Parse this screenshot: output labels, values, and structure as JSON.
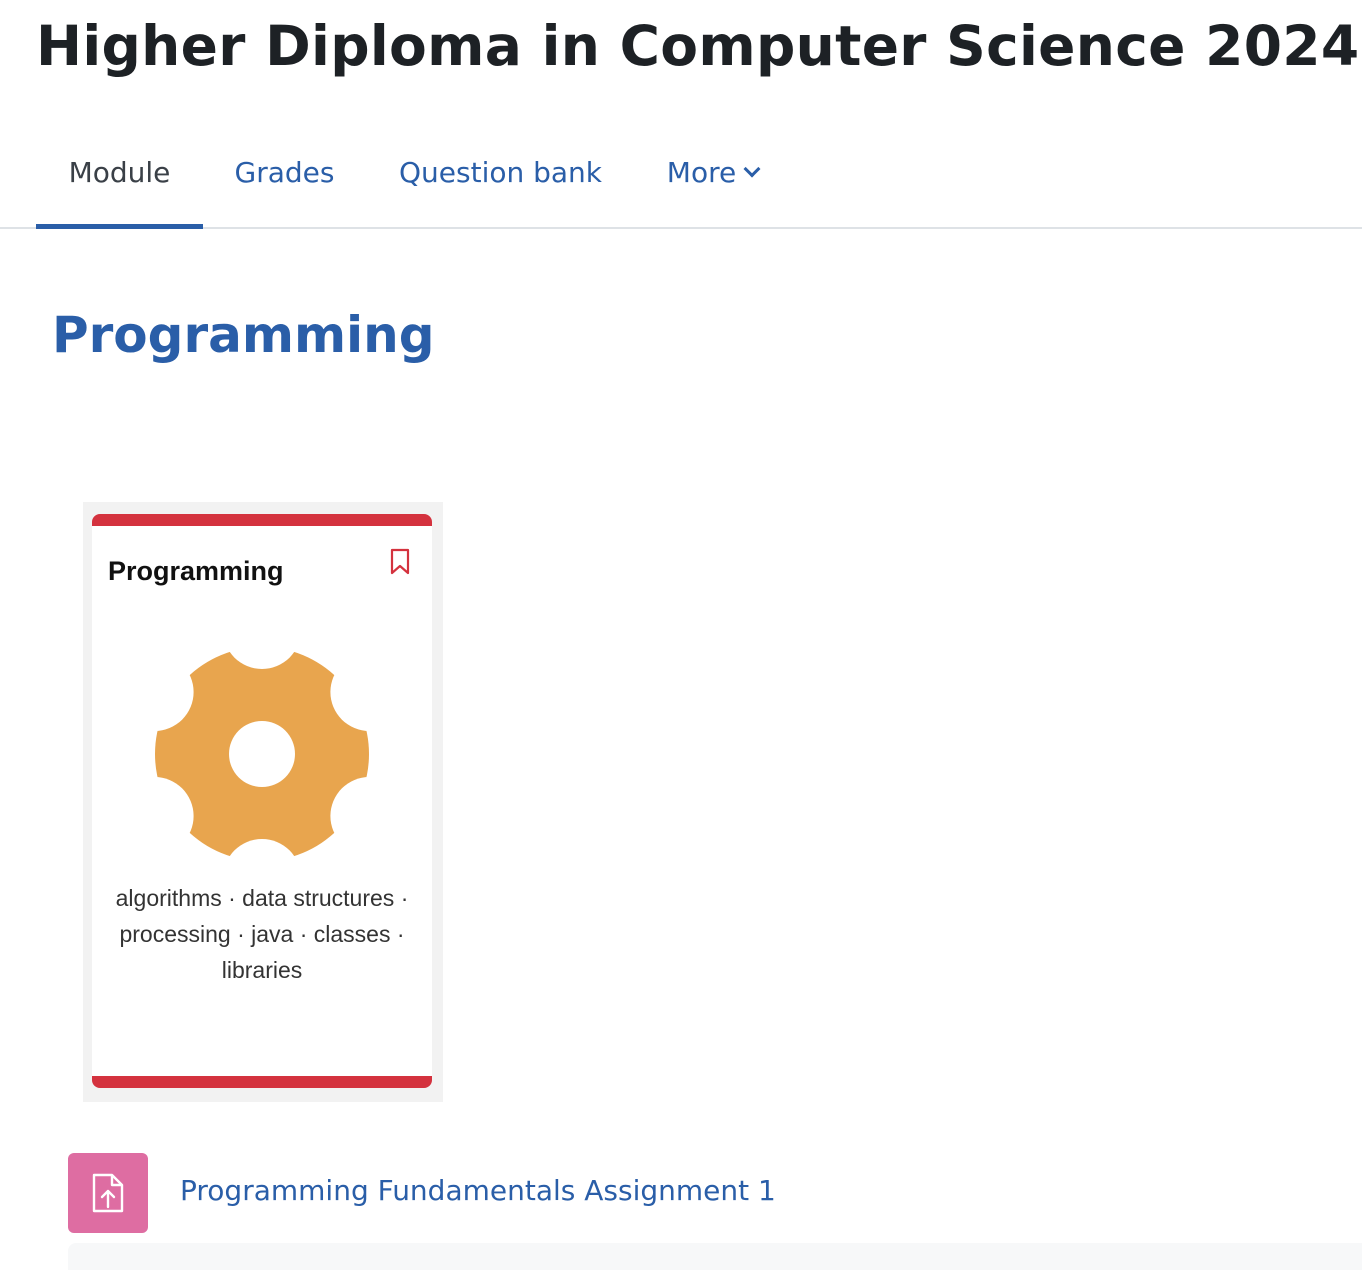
{
  "course": {
    "title": "Higher Diploma in Computer Science 2024"
  },
  "tabs": [
    {
      "label": "Module",
      "active": true
    },
    {
      "label": "Grades",
      "active": false
    },
    {
      "label": "Question bank",
      "active": false
    },
    {
      "label": "More",
      "active": false
    }
  ],
  "section": {
    "title": "Programming"
  },
  "card": {
    "title": "Programming",
    "tags": "algorithms · data structures · processing · java · classes · libraries",
    "icon": "gear-icon",
    "bookmark_icon": "bookmark-icon",
    "accent_color": "#d4323e",
    "gear_color": "#e8a54e"
  },
  "activity": {
    "label": "Programming Fundamentals Assignment 1",
    "icon": "assignment-upload-icon",
    "icon_color": "#de6da2"
  },
  "colors": {
    "link": "#2a5ea8",
    "text": "#1d2125"
  }
}
